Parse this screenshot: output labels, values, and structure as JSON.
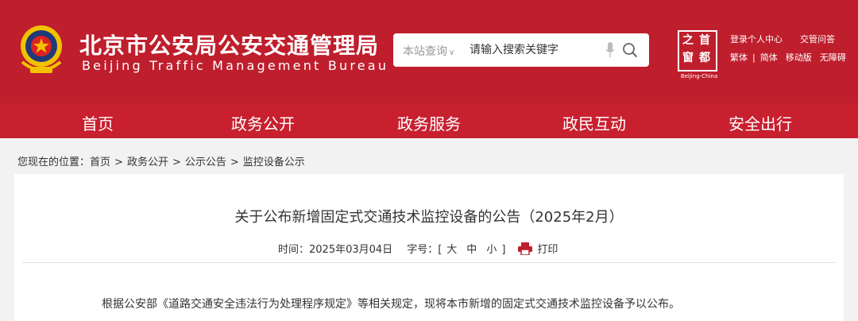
{
  "header": {
    "title_cn": "北京市公安局公安交通管理局",
    "title_en": "Beijing Traffic Management Bureau",
    "search_scope": "本站查询",
    "search_placeholder": "请输入搜索关键字",
    "logo_chars": [
      "首",
      "都",
      "之",
      "窗"
    ],
    "logo_caption": "Beijing-China",
    "links_row1": [
      "登录个人中心",
      "交管问答"
    ],
    "links_row2": [
      "繁体",
      "简体",
      "移动版",
      "无障碍"
    ],
    "brand_color": "#bf1e2d"
  },
  "nav": {
    "items": [
      "首页",
      "政务公开",
      "政务服务",
      "政民互动",
      "安全出行"
    ]
  },
  "breadcrumb": {
    "prefix": "您现在的位置：",
    "items": [
      "首页",
      "政务公开",
      "公示公告",
      "监控设备公示"
    ],
    "separator": ">"
  },
  "article": {
    "title": "关于公布新增固定式交通技术监控设备的公告（2025年2月）",
    "time_label": "时间：",
    "time_value": "2025年03月04日",
    "size_label": "字号：",
    "size_open": "[",
    "size_options": [
      "大",
      "中",
      "小"
    ],
    "size_close": "]",
    "print_label": "打印",
    "paragraph": "根据公安部《道路交通安全违法行为处理程序规定》等相关规定，现将本市新增的固定式交通技术监控设备予以公布。"
  }
}
